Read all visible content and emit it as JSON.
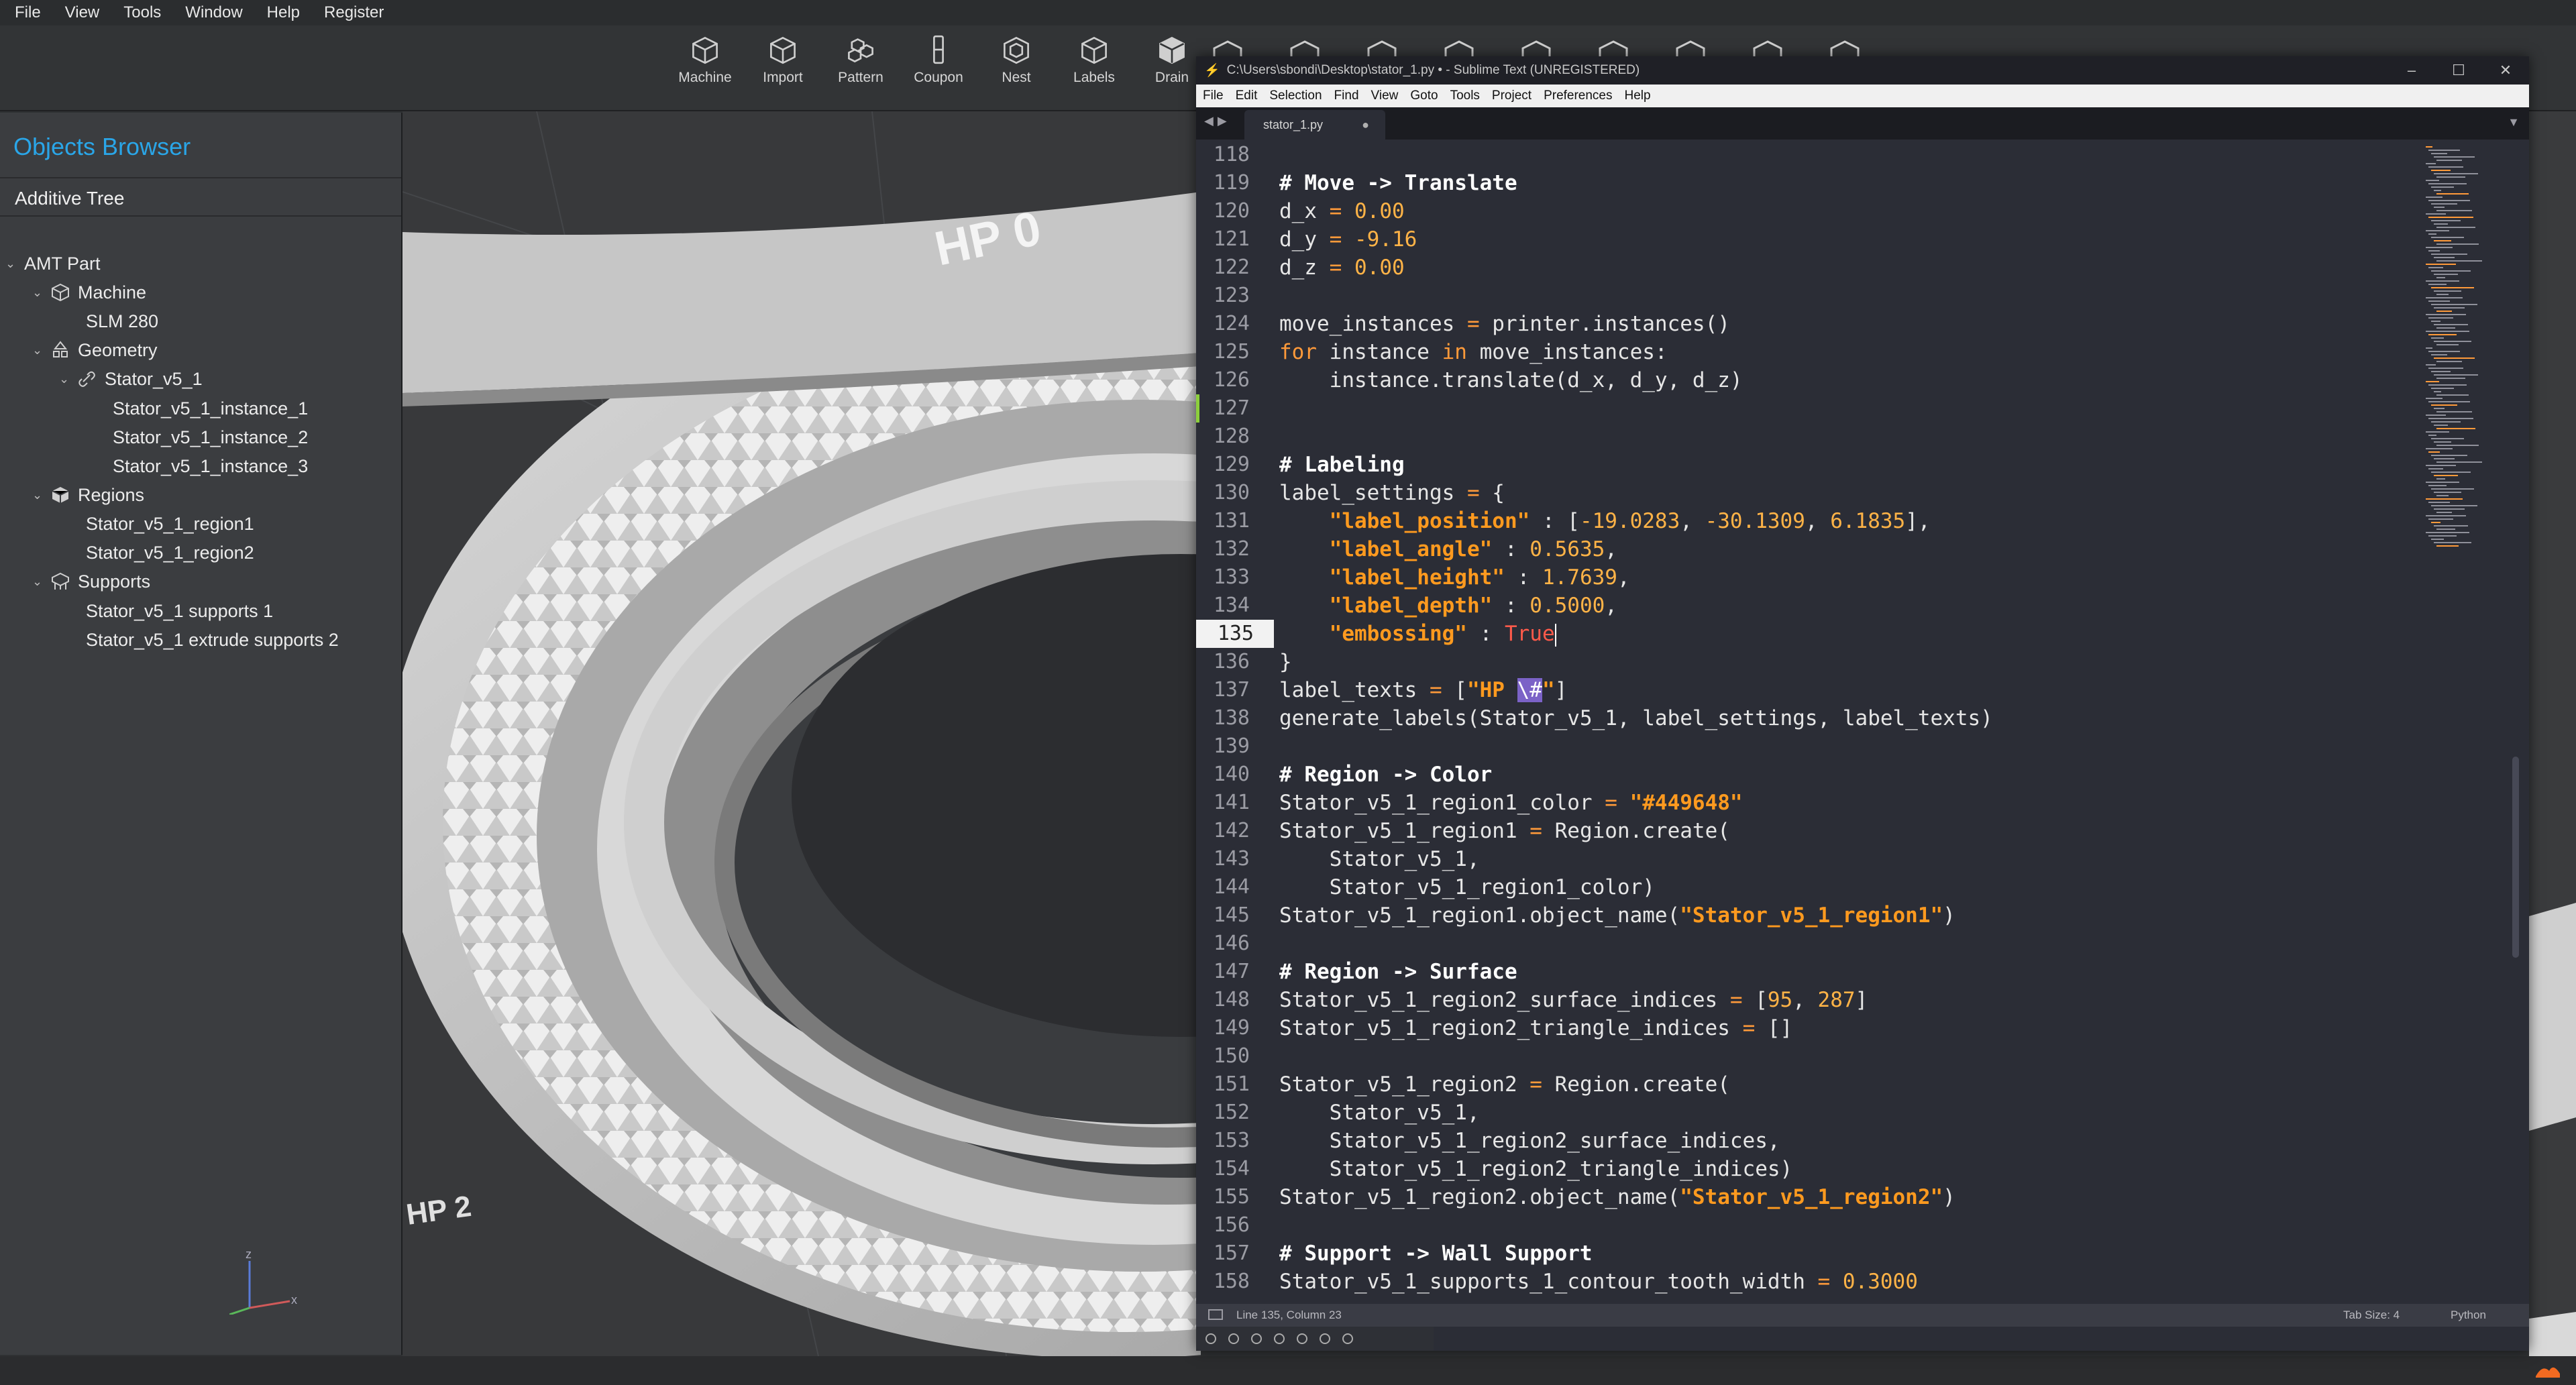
{
  "menubar": [
    "File",
    "View",
    "Tools",
    "Window",
    "Help",
    "Register"
  ],
  "toolbar": [
    {
      "label": "Machine",
      "icon": "machine-icon"
    },
    {
      "label": "Import",
      "icon": "import-icon"
    },
    {
      "label": "Pattern",
      "icon": "pattern-icon"
    },
    {
      "label": "Coupon",
      "icon": "coupon-icon"
    },
    {
      "label": "Nest",
      "icon": "nest-icon"
    },
    {
      "label": "Labels",
      "icon": "labels-icon"
    },
    {
      "label": "Drain",
      "icon": "drain-icon"
    }
  ],
  "objects_browser": {
    "title": "Objects Browser",
    "section": "Additive Tree",
    "tree": [
      {
        "label": "AMT Part",
        "depth": 0,
        "expand": true,
        "icon": ""
      },
      {
        "label": "Machine",
        "depth": 1,
        "expand": true,
        "icon": "machine-icon"
      },
      {
        "label": "SLM 280",
        "depth": 2,
        "expand": false,
        "icon": ""
      },
      {
        "label": "Geometry",
        "depth": 1,
        "expand": true,
        "icon": "geometry-icon"
      },
      {
        "label": "Stator_v5_1",
        "depth": 2,
        "expand": true,
        "icon": "link-icon"
      },
      {
        "label": "Stator_v5_1_instance_1",
        "depth": 3,
        "expand": false,
        "icon": ""
      },
      {
        "label": "Stator_v5_1_instance_2",
        "depth": 3,
        "expand": false,
        "icon": ""
      },
      {
        "label": "Stator_v5_1_instance_3",
        "depth": 3,
        "expand": false,
        "icon": ""
      },
      {
        "label": "Regions",
        "depth": 1,
        "expand": true,
        "icon": "regions-icon"
      },
      {
        "label": "Stator_v5_1_region1",
        "depth": 2,
        "expand": false,
        "icon": ""
      },
      {
        "label": "Stator_v5_1_region2",
        "depth": 2,
        "expand": false,
        "icon": ""
      },
      {
        "label": "Supports",
        "depth": 1,
        "expand": true,
        "icon": "supports-icon"
      },
      {
        "label": "Stator_v5_1 supports 1",
        "depth": 2,
        "expand": false,
        "icon": ""
      },
      {
        "label": "Stator_v5_1 extrude supports 2",
        "depth": 2,
        "expand": false,
        "icon": ""
      }
    ]
  },
  "viewport": {
    "part_label_top": "HP 0",
    "part_label_bottom": "HP 2",
    "axis_z": "z",
    "axis_x": "x"
  },
  "sublime": {
    "title": "C:\\Users\\sbondi\\Desktop\\stator_1.py • - Sublime Text (UNREGISTERED)",
    "menu": [
      "File",
      "Edit",
      "Selection",
      "Find",
      "View",
      "Goto",
      "Tools",
      "Project",
      "Preferences",
      "Help"
    ],
    "tab": "stator_1.py",
    "status_position": "Line 135, Column 23",
    "status_tabsize": "Tab Size: 4",
    "status_syntax": "Python",
    "active_line": 135,
    "lines": [
      {
        "n": "118",
        "t": []
      },
      {
        "n": "119",
        "t": [
          [
            "comment",
            "# Move -> Translate"
          ]
        ]
      },
      {
        "n": "120",
        "t": [
          [
            "plain",
            "d_x "
          ],
          [
            "op",
            "="
          ],
          [
            "plain",
            " "
          ],
          [
            "num",
            "0.00"
          ]
        ]
      },
      {
        "n": "121",
        "t": [
          [
            "plain",
            "d_y "
          ],
          [
            "op",
            "="
          ],
          [
            "plain",
            " "
          ],
          [
            "num",
            "-9.16"
          ]
        ]
      },
      {
        "n": "122",
        "t": [
          [
            "plain",
            "d_z "
          ],
          [
            "op",
            "="
          ],
          [
            "plain",
            " "
          ],
          [
            "num",
            "0.00"
          ]
        ]
      },
      {
        "n": "123",
        "t": []
      },
      {
        "n": "124",
        "t": [
          [
            "plain",
            "move_instances "
          ],
          [
            "op",
            "="
          ],
          [
            "plain",
            " printer.instances()"
          ]
        ]
      },
      {
        "n": "125",
        "t": [
          [
            "kw",
            "for"
          ],
          [
            "plain",
            " instance "
          ],
          [
            "kw",
            "in"
          ],
          [
            "plain",
            " move_instances:"
          ]
        ]
      },
      {
        "n": "126",
        "t": [
          [
            "plain",
            "    instance.translate(d_x, d_y, d_z)"
          ]
        ]
      },
      {
        "n": "127",
        "t": []
      },
      {
        "n": "128",
        "t": []
      },
      {
        "n": "129",
        "t": [
          [
            "comment",
            "# Labeling"
          ]
        ]
      },
      {
        "n": "130",
        "t": [
          [
            "plain",
            "label_settings "
          ],
          [
            "op",
            "="
          ],
          [
            "plain",
            " {"
          ]
        ]
      },
      {
        "n": "131",
        "t": [
          [
            "plain",
            "    "
          ],
          [
            "str",
            "\"label_position\""
          ],
          [
            "plain",
            " : ["
          ],
          [
            "num",
            "-19.0283"
          ],
          [
            "plain",
            ", "
          ],
          [
            "num",
            "-30.1309"
          ],
          [
            "plain",
            ", "
          ],
          [
            "num",
            "6.1835"
          ],
          [
            "plain",
            "],"
          ]
        ]
      },
      {
        "n": "132",
        "t": [
          [
            "plain",
            "    "
          ],
          [
            "str",
            "\"label_angle\""
          ],
          [
            "plain",
            " : "
          ],
          [
            "num",
            "0.5635"
          ],
          [
            "plain",
            ","
          ]
        ]
      },
      {
        "n": "133",
        "t": [
          [
            "plain",
            "    "
          ],
          [
            "str",
            "\"label_height\""
          ],
          [
            "plain",
            " : "
          ],
          [
            "num",
            "1.7639"
          ],
          [
            "plain",
            ","
          ]
        ]
      },
      {
        "n": "134",
        "t": [
          [
            "plain",
            "    "
          ],
          [
            "str",
            "\"label_depth\""
          ],
          [
            "plain",
            " : "
          ],
          [
            "num",
            "0.5000"
          ],
          [
            "plain",
            ","
          ]
        ]
      },
      {
        "n": "135",
        "t": [
          [
            "plain",
            "    "
          ],
          [
            "str",
            "\"embossing\""
          ],
          [
            "plain",
            " : "
          ],
          [
            "bool",
            "True"
          ]
        ],
        "cursor": true
      },
      {
        "n": "136",
        "t": [
          [
            "plain",
            "}"
          ]
        ]
      },
      {
        "n": "137",
        "t": [
          [
            "plain",
            "label_texts "
          ],
          [
            "op",
            "="
          ],
          [
            "plain",
            " ["
          ],
          [
            "str",
            "\"HP "
          ],
          [
            "sel",
            "\\#"
          ],
          [
            "str",
            "\""
          ],
          [
            "plain",
            "]"
          ]
        ]
      },
      {
        "n": "138",
        "t": [
          [
            "plain",
            "generate_labels(Stator_v5_1, label_settings, label_texts)"
          ]
        ]
      },
      {
        "n": "139",
        "t": []
      },
      {
        "n": "140",
        "t": [
          [
            "comment",
            "# Region -> Color"
          ]
        ]
      },
      {
        "n": "141",
        "t": [
          [
            "plain",
            "Stator_v5_1_region1_color "
          ],
          [
            "op",
            "="
          ],
          [
            "plain",
            " "
          ],
          [
            "str",
            "\"#449648\""
          ]
        ]
      },
      {
        "n": "142",
        "t": [
          [
            "plain",
            "Stator_v5_1_region1 "
          ],
          [
            "op",
            "="
          ],
          [
            "plain",
            " Region.create("
          ]
        ]
      },
      {
        "n": "143",
        "t": [
          [
            "plain",
            "    Stator_v5_1,"
          ]
        ]
      },
      {
        "n": "144",
        "t": [
          [
            "plain",
            "    Stator_v5_1_region1_color)"
          ]
        ]
      },
      {
        "n": "145",
        "t": [
          [
            "plain",
            "Stator_v5_1_region1.object_name("
          ],
          [
            "str",
            "\"Stator_v5_1_region1\""
          ],
          [
            "plain",
            ")"
          ]
        ]
      },
      {
        "n": "146",
        "t": []
      },
      {
        "n": "147",
        "t": [
          [
            "comment",
            "# Region -> Surface"
          ]
        ]
      },
      {
        "n": "148",
        "t": [
          [
            "plain",
            "Stator_v5_1_region2_surface_indices "
          ],
          [
            "op",
            "="
          ],
          [
            "plain",
            " ["
          ],
          [
            "num",
            "95"
          ],
          [
            "plain",
            ", "
          ],
          [
            "num",
            "287"
          ],
          [
            "plain",
            "]"
          ]
        ]
      },
      {
        "n": "149",
        "t": [
          [
            "plain",
            "Stator_v5_1_region2_triangle_indices "
          ],
          [
            "op",
            "="
          ],
          [
            "plain",
            " []"
          ]
        ]
      },
      {
        "n": "150",
        "t": []
      },
      {
        "n": "151",
        "t": [
          [
            "plain",
            "Stator_v5_1_region2 "
          ],
          [
            "op",
            "="
          ],
          [
            "plain",
            " Region.create("
          ]
        ]
      },
      {
        "n": "152",
        "t": [
          [
            "plain",
            "    Stator_v5_1,"
          ]
        ]
      },
      {
        "n": "153",
        "t": [
          [
            "plain",
            "    Stator_v5_1_region2_surface_indices,"
          ]
        ]
      },
      {
        "n": "154",
        "t": [
          [
            "plain",
            "    Stator_v5_1_region2_triangle_indices)"
          ]
        ]
      },
      {
        "n": "155",
        "t": [
          [
            "plain",
            "Stator_v5_1_region2.object_name("
          ],
          [
            "str",
            "\"Stator_v5_1_region2\""
          ],
          [
            "plain",
            ")"
          ]
        ]
      },
      {
        "n": "156",
        "t": []
      },
      {
        "n": "157",
        "t": [
          [
            "comment",
            "# Support -> Wall Support"
          ]
        ]
      },
      {
        "n": "158",
        "t": [
          [
            "plain",
            "Stator_v5_1_supports_1_contour_tooth_width "
          ],
          [
            "op",
            "="
          ],
          [
            "plain",
            " "
          ],
          [
            "num",
            "0.3000"
          ]
        ]
      }
    ]
  }
}
